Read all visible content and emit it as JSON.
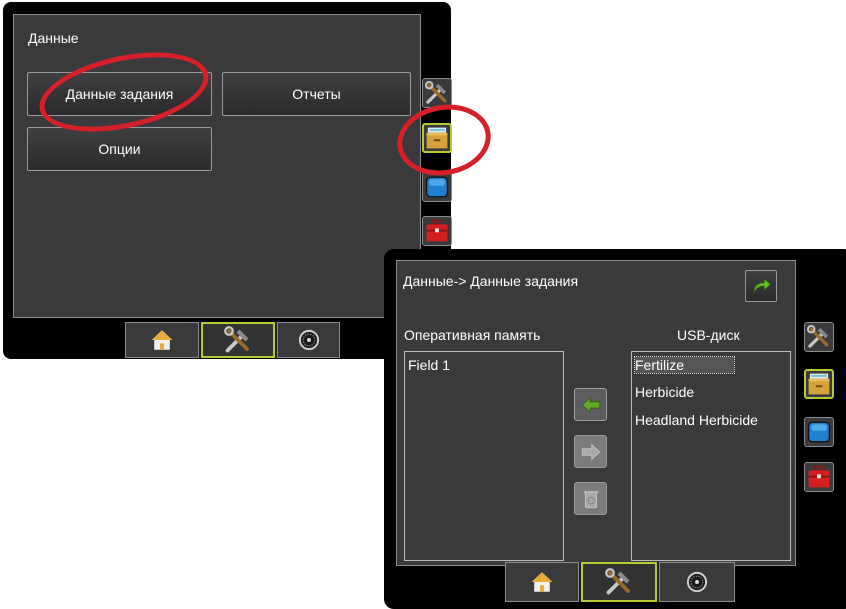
{
  "screen1": {
    "title": "Данные",
    "buttons": {
      "job_data": "Данные задания",
      "reports": "Отчеты",
      "options": "Опции"
    }
  },
  "screen2": {
    "breadcrumb": "Данные-> Данные задания",
    "internal_memory_label": "Оперативная память",
    "usb_label": "USB-диск",
    "internal_items": [
      "Field 1"
    ],
    "usb_items": [
      "Fertilize",
      "Herbicide",
      "Headland Herbicide"
    ],
    "selected_usb_item": "Fertilize"
  },
  "side_tabs": [
    "tools-icon",
    "data-drawer-icon",
    "display-icon",
    "toolbox-icon"
  ],
  "active_side_tab": "data-drawer-icon",
  "nav_tabs": [
    "home-icon",
    "tools-icon",
    "gauge-icon"
  ],
  "active_nav_tab": "tools-icon",
  "colors": {
    "highlight_ring": "#d61f26",
    "active_border": "#b9c930",
    "arrow_green": "#5fa829"
  }
}
